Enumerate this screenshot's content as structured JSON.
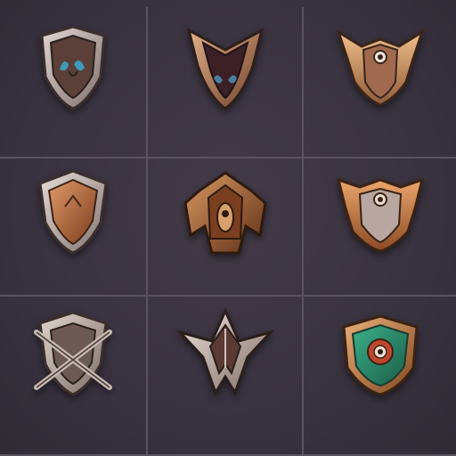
{
  "sheet": {
    "title": "",
    "background": "#3a3440",
    "divider_color": "#5a5260"
  },
  "emblems": [
    {
      "label": "",
      "icon": "silver-shield-blue-gem-icon",
      "metal": "#b8aaa6",
      "gem": "#3f7f9a"
    },
    {
      "label": "",
      "icon": "horned-dark-shield-icon",
      "metal": "#a56b4e",
      "gem": "#3c5f7a"
    },
    {
      "label": "",
      "icon": "winged-bronze-shield-eye-icon",
      "metal": "#d69a6a",
      "gem": "#f0e6da"
    },
    {
      "label": "",
      "icon": "copper-kite-shield-icon",
      "metal": "#b8aaa6",
      "gem": "#c07042"
    },
    {
      "label": "",
      "icon": "ornate-bronze-crest-icon",
      "metal": "#a8612f",
      "gem": "#d8a06a"
    },
    {
      "label": "",
      "icon": "copper-winged-shield-eye-icon",
      "metal": "#c97c44",
      "gem": "#e6dcd2"
    },
    {
      "label": "",
      "icon": "crossed-swords-shield-icon",
      "metal": "#b3a39c",
      "gem": "#6b5a55"
    },
    {
      "label": "",
      "icon": "spiked-dark-crest-icon",
      "metal": "#c4b5ad",
      "gem": "#5a3a34"
    },
    {
      "label": "",
      "icon": "emerald-shield-eye-icon",
      "metal": "#c98850",
      "gem": "#2f8f6a"
    }
  ]
}
